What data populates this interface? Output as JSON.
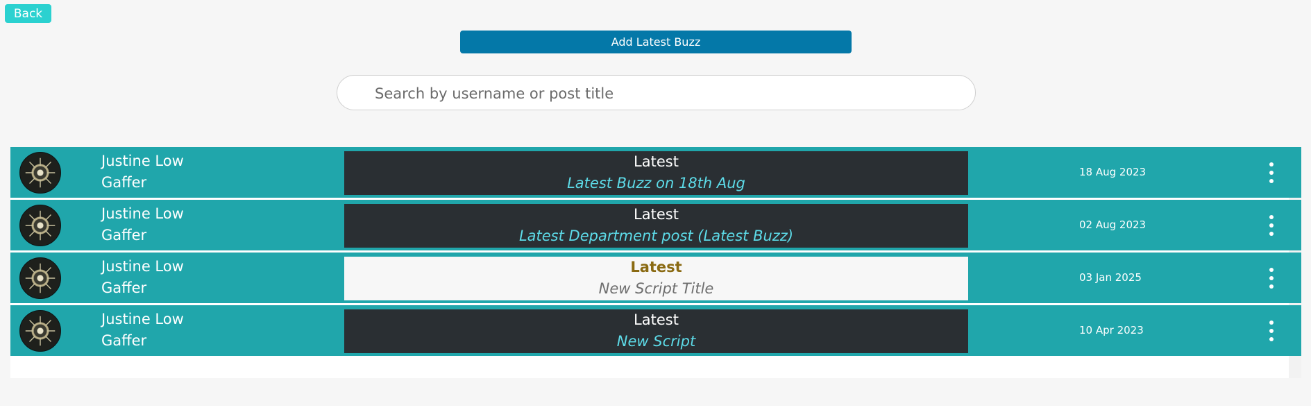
{
  "header": {
    "back_label": "Back",
    "add_label": "Add Latest Buzz"
  },
  "search": {
    "placeholder": "Search by username or post title",
    "value": ""
  },
  "colors": {
    "row_bg": "#20a6ab",
    "post_dark_bg": "#2a2f33",
    "post_light_bg": "#f7f7f7",
    "accent_button": "#0478a8",
    "back_button": "#2bd1d0"
  },
  "posts": [
    {
      "user": "Justine Low",
      "role": "Gaffer",
      "category": "Latest",
      "title": "Latest Buzz on 18th Aug",
      "date": "18 Aug 2023",
      "avatar_icon": "avatar-icon",
      "menu_icon": "more-vertical-icon"
    },
    {
      "user": "Justine Low",
      "role": "Gaffer",
      "category": "Latest",
      "title": "Latest Department post (Latest Buzz)",
      "date": "02 Aug 2023",
      "avatar_icon": "avatar-icon",
      "menu_icon": "more-vertical-icon"
    },
    {
      "user": "Justine Low",
      "role": "Gaffer",
      "category": "Latest",
      "title": "New Script Title",
      "date": "03 Jan 2025",
      "avatar_icon": "avatar-icon",
      "menu_icon": "more-vertical-icon"
    },
    {
      "user": "Justine Low",
      "role": "Gaffer",
      "category": "Latest",
      "title": "New Script",
      "date": "10 Apr 2023",
      "avatar_icon": "avatar-icon",
      "menu_icon": "more-vertical-icon"
    }
  ]
}
